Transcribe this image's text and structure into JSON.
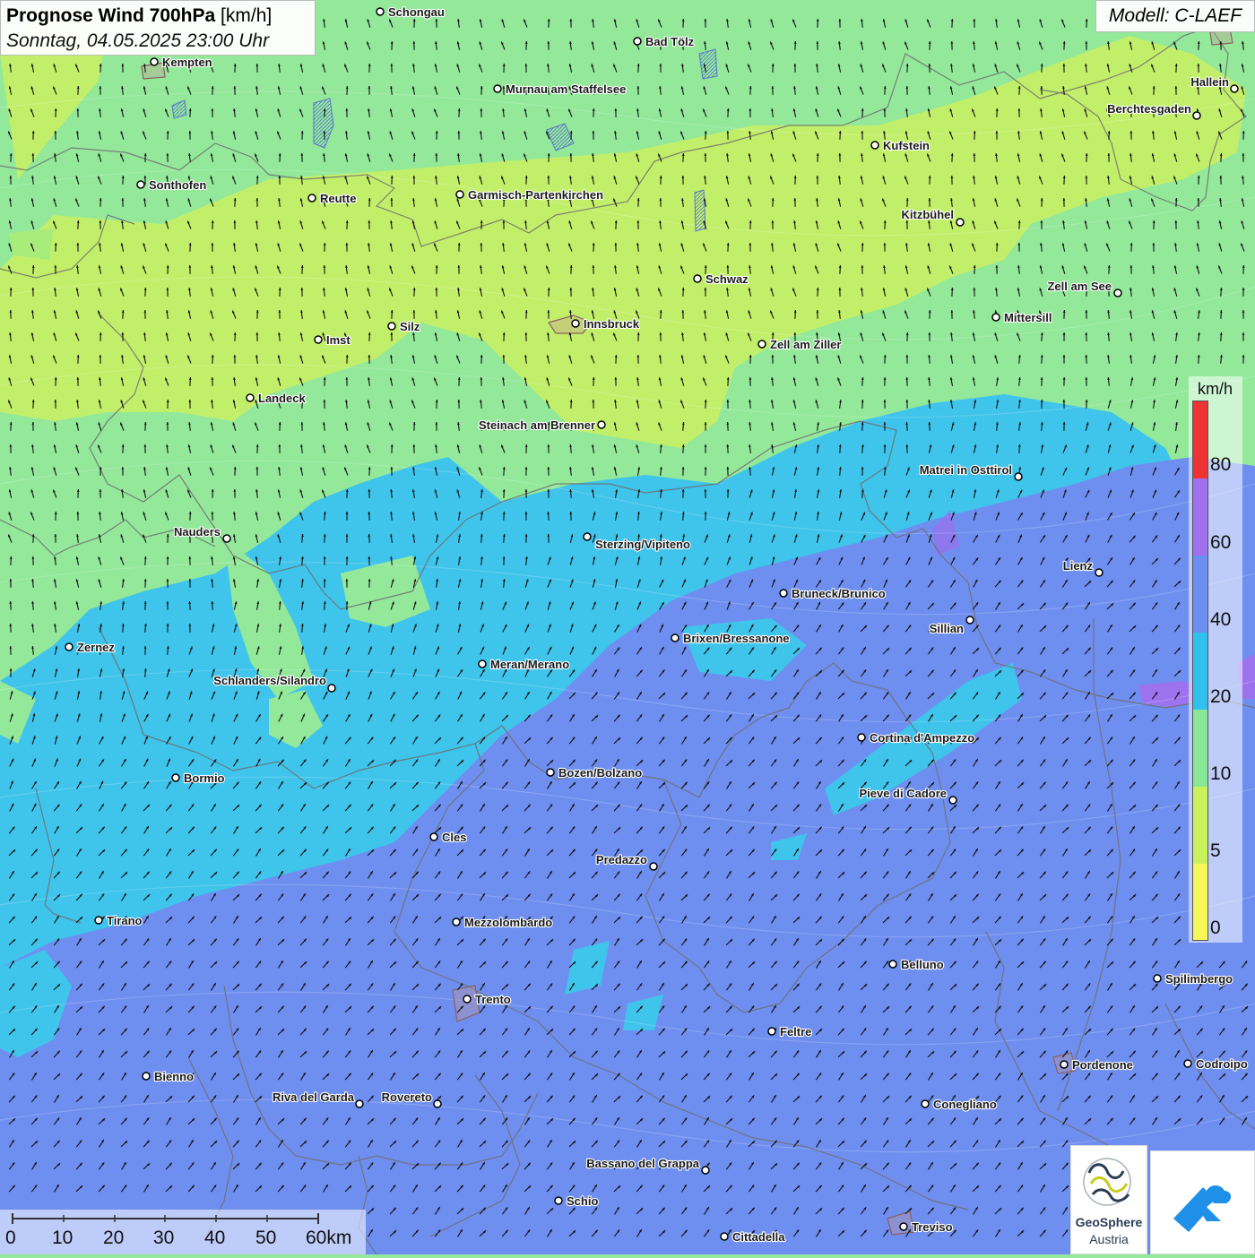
{
  "title": {
    "main": "Prognose Wind 700hPa",
    "unit": "[km/h]",
    "date": "Sonntag, 04.05.2025 23:00 Uhr"
  },
  "model": "Modell: C-LAEF",
  "legend": {
    "unit": "km/h",
    "labels": [
      "80",
      "60",
      "40",
      "20",
      "10",
      "5",
      "0"
    ],
    "colors": [
      "#ee3333",
      "#a070ee",
      "#6a8ff0",
      "#2fc0ee",
      "#88e896",
      "#c8f25a",
      "#f7f75a"
    ]
  },
  "scale": {
    "labels": [
      "0",
      "10",
      "20",
      "30",
      "40",
      "50",
      "60km"
    ]
  },
  "branding": {
    "name": "GeoSphere",
    "sub": "Austria"
  },
  "cities": [
    {
      "name": "Schongau"
    },
    {
      "name": "Bad Tölz"
    },
    {
      "name": "Kempten"
    },
    {
      "name": "Murnau am Staffelsee"
    },
    {
      "name": "Hallein"
    },
    {
      "name": "Berchtesgaden"
    },
    {
      "name": "Kufstein"
    },
    {
      "name": "Sonthofen"
    },
    {
      "name": "Reutte"
    },
    {
      "name": "Garmisch-Partenkirchen"
    },
    {
      "name": "Kitzbühel"
    },
    {
      "name": "Schwaz"
    },
    {
      "name": "Zell am See"
    },
    {
      "name": "Mittersill"
    },
    {
      "name": "Imst"
    },
    {
      "name": "Silz"
    },
    {
      "name": "Innsbruck"
    },
    {
      "name": "Zell am Ziller"
    },
    {
      "name": "Landeck"
    },
    {
      "name": "Steinach am Brenner"
    },
    {
      "name": "Matrei in Osttirol"
    },
    {
      "name": "Nauders"
    },
    {
      "name": "Sterzing/Vipiteno"
    },
    {
      "name": "Lienz"
    },
    {
      "name": "Bruneck/Brunico"
    },
    {
      "name": "Sillian"
    },
    {
      "name": "Brixen/Bressanone"
    },
    {
      "name": "Zernez"
    },
    {
      "name": "Meran/Merano"
    },
    {
      "name": "Schlanders/Silandro"
    },
    {
      "name": "Cortina d'Ampezzo"
    },
    {
      "name": "Bozen/Bolzano"
    },
    {
      "name": "Bormio"
    },
    {
      "name": "Pieve di Cadore"
    },
    {
      "name": "Cles"
    },
    {
      "name": "Predazzo"
    },
    {
      "name": "Tirano"
    },
    {
      "name": "Mezzolombardo"
    },
    {
      "name": "Belluno"
    },
    {
      "name": "Spilimbergo"
    },
    {
      "name": "Trento"
    },
    {
      "name": "Feltre"
    },
    {
      "name": "Pordenone"
    },
    {
      "name": "Codroipo"
    },
    {
      "name": "Bienno"
    },
    {
      "name": "Riva del Garda"
    },
    {
      "name": "Rovereto"
    },
    {
      "name": "Conegliano"
    },
    {
      "name": "Bassano del Grappa"
    },
    {
      "name": "Schio"
    },
    {
      "name": "Treviso"
    },
    {
      "name": "Cittadella"
    }
  ]
}
